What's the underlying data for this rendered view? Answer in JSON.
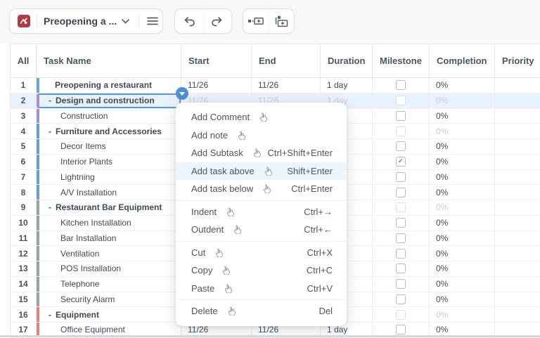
{
  "toolbar": {
    "project_title": "Preopening a ...",
    "brand_color": "#b23a42"
  },
  "colors": {
    "accent_blue": "#4a90d8",
    "selection_bg": "#e9f2fb",
    "menu_highlight_bg": "#edf4fa"
  },
  "table": {
    "columns": [
      {
        "label": "All"
      },
      {
        "label": "Task Name"
      },
      {
        "label": "Start"
      },
      {
        "label": "End"
      },
      {
        "label": "Duration"
      },
      {
        "label": "Milestone"
      },
      {
        "label": "Completion"
      },
      {
        "label": "Priority"
      }
    ],
    "rows": [
      {
        "num": "1",
        "name": "Preopening a restaurant",
        "type": "project",
        "bar": "#74a2d0",
        "start": "11/26",
        "end": "11/26",
        "duration": "1 day",
        "milestone": false,
        "completion": "0%",
        "faded": false,
        "selected": false
      },
      {
        "num": "2",
        "name": "Design and construction",
        "type": "group",
        "bar": "#a891cb",
        "start": "11/26",
        "end": "11/26",
        "duration": "1 day",
        "milestone": false,
        "completion": "0%",
        "faded": true,
        "selected": true
      },
      {
        "num": "3",
        "name": "Construction",
        "type": "task",
        "bar": "#a891cb",
        "start": "",
        "end": "",
        "duration": "",
        "milestone": false,
        "completion": "0%",
        "faded": false,
        "selected": false
      },
      {
        "num": "4",
        "name": "Furniture and Accessories",
        "type": "group",
        "bar": "#6e9cc9",
        "start": "",
        "end": "",
        "duration": "",
        "milestone": false,
        "completion": "0%",
        "faded": true,
        "selected": false
      },
      {
        "num": "5",
        "name": "Decor Items",
        "type": "task",
        "bar": "#6e9cc9",
        "start": "",
        "end": "",
        "duration": "",
        "milestone": false,
        "completion": "0%",
        "faded": false,
        "selected": false
      },
      {
        "num": "6",
        "name": "Interior Plants",
        "type": "task",
        "bar": "#6e9cc9",
        "start": "",
        "end": "",
        "duration": "",
        "milestone": true,
        "completion": "0%",
        "faded": false,
        "selected": false
      },
      {
        "num": "7",
        "name": "Lightning",
        "type": "task",
        "bar": "#6e9cc9",
        "start": "",
        "end": "",
        "duration": "",
        "milestone": false,
        "completion": "0%",
        "faded": false,
        "selected": false
      },
      {
        "num": "8",
        "name": "A/V Installation",
        "type": "task",
        "bar": "#6e9cc9",
        "start": "",
        "end": "",
        "duration": "",
        "milestone": false,
        "completion": "0%",
        "faded": false,
        "selected": false
      },
      {
        "num": "9",
        "name": "Restaurant Bar Equipment",
        "type": "group",
        "bar": "#9aa1a8",
        "start": "",
        "end": "",
        "duration": "",
        "milestone": false,
        "completion": "0%",
        "faded": true,
        "selected": false
      },
      {
        "num": "10",
        "name": "Kitchen Installation",
        "type": "task",
        "bar": "#9aa1a8",
        "start": "",
        "end": "",
        "duration": "",
        "milestone": false,
        "completion": "0%",
        "faded": false,
        "selected": false
      },
      {
        "num": "11",
        "name": "Bar Installation",
        "type": "task",
        "bar": "#9aa1a8",
        "start": "",
        "end": "",
        "duration": "",
        "milestone": false,
        "completion": "0%",
        "faded": false,
        "selected": false
      },
      {
        "num": "12",
        "name": "Ventilation",
        "type": "task",
        "bar": "#9aa1a8",
        "start": "",
        "end": "",
        "duration": "",
        "milestone": false,
        "completion": "0%",
        "faded": false,
        "selected": false
      },
      {
        "num": "13",
        "name": "POS Installation",
        "type": "task",
        "bar": "#9aa1a8",
        "start": "",
        "end": "",
        "duration": "",
        "milestone": false,
        "completion": "0%",
        "faded": false,
        "selected": false
      },
      {
        "num": "14",
        "name": "Telephone",
        "type": "task",
        "bar": "#9aa1a8",
        "start": "",
        "end": "",
        "duration": "",
        "milestone": false,
        "completion": "0%",
        "faded": false,
        "selected": false
      },
      {
        "num": "15",
        "name": "Security Alarm",
        "type": "task",
        "bar": "#9aa1a8",
        "start": "",
        "end": "",
        "duration": "",
        "milestone": false,
        "completion": "0%",
        "faded": false,
        "selected": false
      },
      {
        "num": "16",
        "name": "Equipment",
        "type": "group",
        "bar": "#e0837d",
        "start": "",
        "end": "",
        "duration": "",
        "milestone": false,
        "completion": "0%",
        "faded": true,
        "selected": false
      },
      {
        "num": "17",
        "name": "Office Equipment",
        "type": "task",
        "bar": "#e0837d",
        "start": "11/26",
        "end": "11/26",
        "duration": "1 day",
        "milestone": false,
        "completion": "0%",
        "faded": false,
        "selected": false
      }
    ]
  },
  "context_menu": {
    "groups": [
      [
        {
          "label": "Add Comment",
          "shortcut": ""
        },
        {
          "label": "Add note",
          "shortcut": ""
        },
        {
          "label": "Add Subtask",
          "shortcut": "Ctrl+Shift+Enter"
        },
        {
          "label": "Add task above",
          "shortcut": "Shift+Enter",
          "highlighted": true
        },
        {
          "label": "Add task below",
          "shortcut": "Ctrl+Enter"
        }
      ],
      [
        {
          "label": "Indent",
          "shortcut": "Ctrl+→"
        },
        {
          "label": "Outdent",
          "shortcut": "Ctrl+←"
        }
      ],
      [
        {
          "label": "Cut",
          "shortcut": "Ctrl+X"
        },
        {
          "label": "Copy",
          "shortcut": "Ctrl+C"
        },
        {
          "label": "Paste",
          "shortcut": "Ctrl+V"
        }
      ],
      [
        {
          "label": "Delete",
          "shortcut": "Del"
        }
      ]
    ]
  }
}
